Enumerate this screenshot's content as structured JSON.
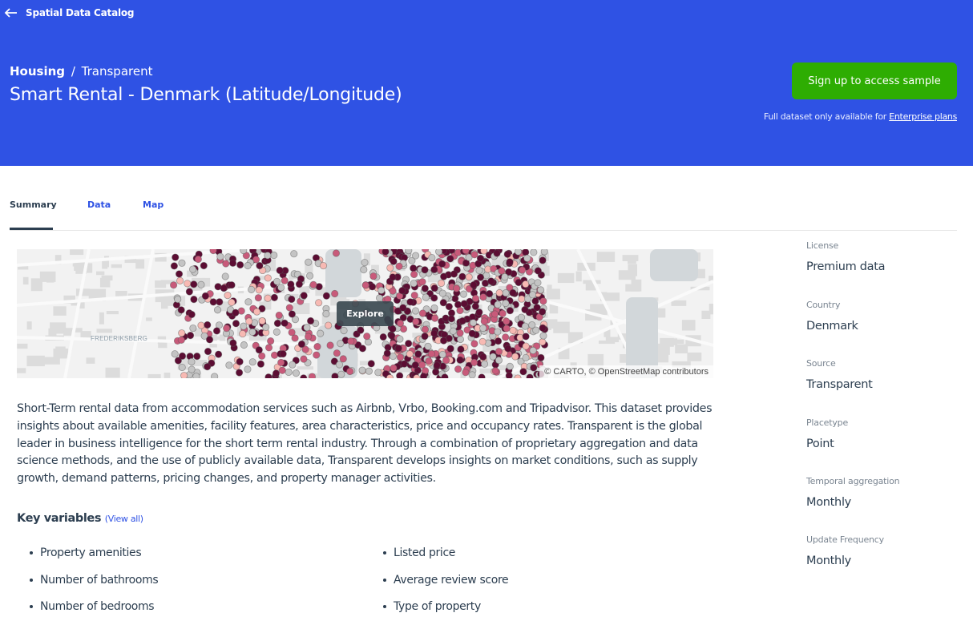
{
  "header": {
    "back_label": "Spatial Data Catalog",
    "breadcrumb_category": "Housing",
    "breadcrumb_separator": "/",
    "breadcrumb_provider": "Transparent",
    "title": "Smart Rental - Denmark (Latitude/Longitude)",
    "cta_label": "Sign up to access sample",
    "cta_note_prefix": "Full dataset only available for ",
    "cta_note_link": "Enterprise plans",
    "colors": {
      "background": "#2f52e4",
      "cta": "#2ead02"
    }
  },
  "tabs": [
    {
      "label": "Summary",
      "active": true
    },
    {
      "label": "Data",
      "active": false
    },
    {
      "label": "Map",
      "active": false
    }
  ],
  "map": {
    "explore_label": "Explore",
    "attribution": "© CARTO, © OpenStreetMap contributors",
    "place_label": "FREDERIKSBERG",
    "point_colors": [
      "#5c0d33",
      "#c85a7a",
      "#f7b9b3",
      "#c4c4c4"
    ]
  },
  "description": "Short-Term rental data from accommodation services such as Airbnb, Vrbo, Booking.com and Tripadvisor. This dataset provides insights about available amenities, facility features, area characteristics, price and occupancy rates. Transparent is the global leader in business intelligence for the short term rental industry. Through a combination of proprietary aggregation and data science methods, and the use of publicly available data, Transparent develops insights on market conditions, such as supply growth, demand patterns, pricing changes, and property manager activities.",
  "key_variables": {
    "title": "Key variables",
    "view_all": "(View all)",
    "left": [
      "Property amenities",
      "Number of bathrooms",
      "Number of bedrooms"
    ],
    "right": [
      "Listed price",
      "Average review score",
      "Type of property"
    ]
  },
  "metadata": [
    {
      "label": "License",
      "value": "Premium data"
    },
    {
      "label": "Country",
      "value": "Denmark"
    },
    {
      "label": "Source",
      "value": "Transparent"
    },
    {
      "label": "Placetype",
      "value": "Point"
    },
    {
      "label": "Temporal aggregation",
      "value": "Monthly"
    },
    {
      "label": "Update Frequency",
      "value": "Monthly"
    }
  ]
}
